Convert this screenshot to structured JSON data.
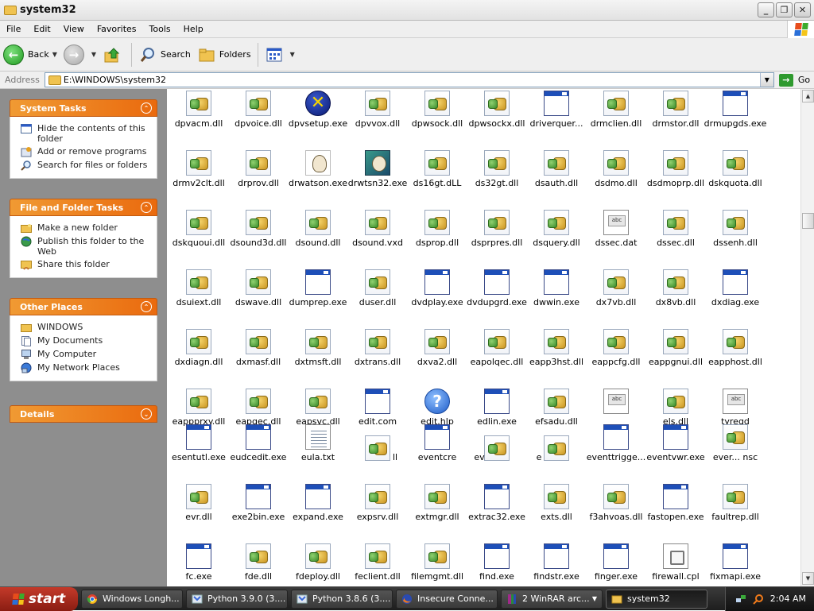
{
  "window": {
    "title": "system32"
  },
  "menubar": {
    "items": [
      "File",
      "Edit",
      "View",
      "Favorites",
      "Tools",
      "Help"
    ]
  },
  "toolbar": {
    "back_label": "Back",
    "search_label": "Search",
    "folders_label": "Folders"
  },
  "address": {
    "label": "Address",
    "value": "E:\\WINDOWS\\system32",
    "go_label": "Go"
  },
  "system_tasks": {
    "title": "System Tasks",
    "items": [
      "Hide the contents of this folder",
      "Add or remove programs",
      "Search for files or folders"
    ]
  },
  "file_tasks": {
    "title": "File and Folder Tasks",
    "items": [
      "Make a new folder",
      "Publish this folder to the Web",
      "Share this folder"
    ]
  },
  "other_places": {
    "title": "Other Places",
    "items": [
      "WINDOWS",
      "My Documents",
      "My Computer",
      "My Network Places"
    ]
  },
  "details": {
    "title": "Details"
  },
  "files": {
    "r0": [
      "dpvacm.dll",
      "dpvoice.dll",
      "dpvsetup.exe",
      "dpvvox.dll",
      "dpwsock.dll",
      "dpwsockx.dll",
      "driverquer...",
      "drmclien.dll",
      "drmstor.dll",
      "drmupgds.exe"
    ],
    "r1": [
      "drmv2clt.dll",
      "drprov.dll",
      "drwatson.exe",
      "drwtsn32.exe",
      "ds16gt.dLL",
      "ds32gt.dll",
      "dsauth.dll",
      "dsdmo.dll",
      "dsdmoprp.dll",
      "dskquota.dll"
    ],
    "r2": [
      "dskquoui.dll",
      "dsound3d.dll",
      "dsound.dll",
      "dsound.vxd",
      "dsprop.dll",
      "dsprpres.dll",
      "dsquery.dll",
      "dssec.dat",
      "dssec.dll",
      "dssenh.dll"
    ],
    "r3": [
      "dsuiext.dll",
      "dswave.dll",
      "dumprep.exe",
      "duser.dll",
      "dvdplay.exe",
      "dvdupgrd.exe",
      "dwwin.exe",
      "dx7vb.dll",
      "dx8vb.dll",
      "dxdiag.exe"
    ],
    "r4": [
      "dxdiagn.dll",
      "dxmasf.dll",
      "dxtmsft.dll",
      "dxtrans.dll",
      "dxva2.dll",
      "eapolqec.dll",
      "eapp3hst.dll",
      "eappcfg.dll",
      "eappgnui.dll",
      "eapphost.dll"
    ],
    "r5": [
      "eappprxy.dll",
      "eapqec.dll",
      "eapsvc.dll",
      "edit.com",
      "edit.hlp",
      "edlin.exe",
      "efsadu.dll",
      "",
      "els.dll",
      "tyregd"
    ],
    "r6": [
      "esentutl.exe",
      "eudcedit.exe",
      "eula.txt",
      "ll",
      "eventcre",
      "ev",
      "e",
      "eventtrigge...",
      "eventvwr.exe",
      "ever... nsc"
    ],
    "r7": [
      "evr.dll",
      "exe2bin.exe",
      "expand.exe",
      "expsrv.dll",
      "extmgr.dll",
      "extrac32.exe",
      "exts.dll",
      "f3ahvoas.dll",
      "fastopen.exe",
      "faultrep.dll"
    ],
    "r8": [
      "fc.exe",
      "fde.dll",
      "fdeploy.dll",
      "feclient.dll",
      "filemgmt.dll",
      "find.exe",
      "findstr.exe",
      "finger.exe",
      "firewall.cpl",
      "fixmapi.exe"
    ]
  },
  "taskbar": {
    "start_label": "start",
    "buttons": [
      "Windows Longh...",
      "Python 3.9.0 (3....",
      "Python 3.8.6 (3....",
      "Insecure Conne...",
      "2 WinRAR arc...",
      "system32"
    ],
    "clock": "2:04 AM"
  },
  "colors": {
    "panel_header": "#ea6a0e",
    "left_pane_bg": "#8e8e8e",
    "exe_titlebar": "#1e4fb8"
  }
}
